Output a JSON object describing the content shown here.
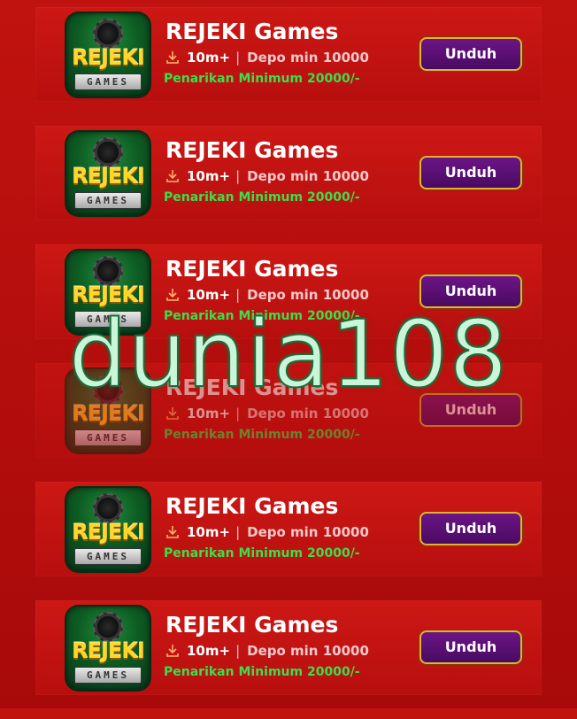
{
  "apps": [
    {
      "title": "REJEKI Games",
      "downloads": "10m+",
      "separator": "|",
      "deposit": "Depo min 10000",
      "withdraw": "Penarikan Minimum 20000/-",
      "button": "Unduh",
      "icon_brand": "REJEKI",
      "icon_sub": "GAMES"
    },
    {
      "title": "REJEKI Games",
      "downloads": "10m+",
      "separator": "|",
      "deposit": "Depo min 10000",
      "withdraw": "Penarikan Minimum 20000/-",
      "button": "Unduh",
      "icon_brand": "REJEKI",
      "icon_sub": "GAMES"
    },
    {
      "title": "REJEKI Games",
      "downloads": "10m+",
      "separator": "|",
      "deposit": "Depo min 10000",
      "withdraw": "Penarikan Minimum 20000/-",
      "button": "Unduh",
      "icon_brand": "REJEKI",
      "icon_sub": "GAMES"
    },
    {
      "title": "REJEKI Games",
      "downloads": "10m+",
      "separator": "|",
      "deposit": "Depo min 10000",
      "withdraw": "Penarikan Minimum 20000/-",
      "button": "Unduh",
      "icon_brand": "REJEKI",
      "icon_sub": "GAMES"
    },
    {
      "title": "REJEKI Games",
      "downloads": "10m+",
      "separator": "|",
      "deposit": "Depo min 10000",
      "withdraw": "Penarikan Minimum 20000/-",
      "button": "Unduh",
      "icon_brand": "REJEKI",
      "icon_sub": "GAMES"
    },
    {
      "title": "REJEKI Games",
      "downloads": "10m+",
      "separator": "|",
      "deposit": "Depo min 10000",
      "withdraw": "Penarikan Minimum 20000/-",
      "button": "Unduh",
      "icon_brand": "REJEKI",
      "icon_sub": "GAMES"
    }
  ],
  "watermark": "dunia108",
  "icons": {
    "download": "download-icon"
  },
  "colors": {
    "background": "#b40c0c",
    "card": "#c21412",
    "button": "#5a0f75",
    "button_border": "#e8b030",
    "withdraw_text": "#39e04a",
    "watermark": "#c9f5d9"
  }
}
